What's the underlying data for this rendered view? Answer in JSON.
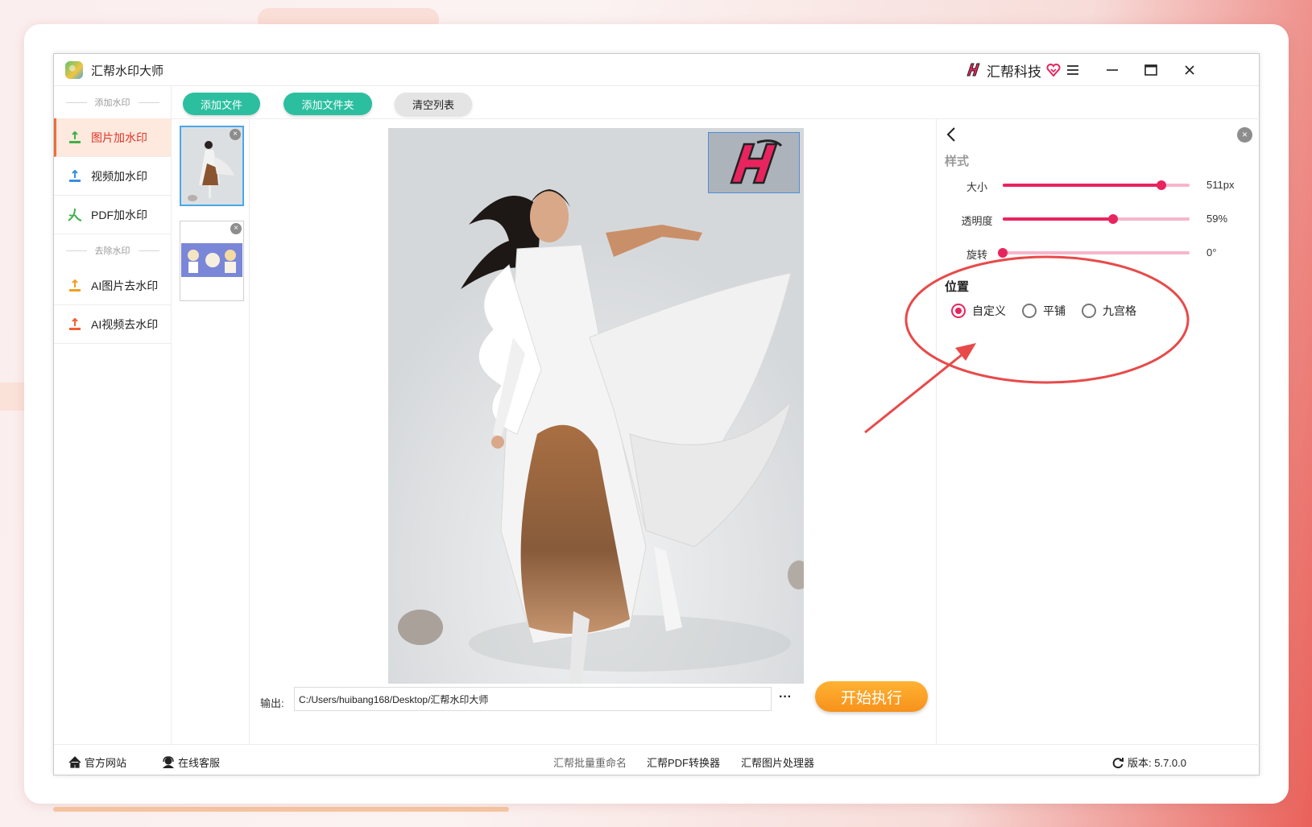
{
  "window": {
    "title": "汇帮水印大师",
    "brand": "汇帮科技"
  },
  "sidebar": {
    "section_add": "添加水印",
    "section_remove": "去除水印",
    "items_add": [
      {
        "label": "图片加水印",
        "icon": "image-upload-icon",
        "color": "#3fb04b"
      },
      {
        "label": "视频加水印",
        "icon": "video-upload-icon",
        "color": "#3a8fe0"
      },
      {
        "label": "PDF加水印",
        "icon": "pdf-icon",
        "color": "#3fb04b"
      }
    ],
    "items_remove": [
      {
        "label": "AI图片去水印",
        "icon": "image-remove-icon",
        "color": "#f0a020"
      },
      {
        "label": "AI视频去水印",
        "icon": "video-remove-icon",
        "color": "#f06030"
      }
    ]
  },
  "toolbar": {
    "add_file": "添加文件",
    "add_folder": "添加文件夹",
    "clear_list": "清空列表"
  },
  "output": {
    "label": "输出:",
    "path": "C:/Users/huibang168/Desktop/汇帮水印大师",
    "more": "···",
    "start": "开始执行"
  },
  "panel": {
    "style_title": "样式",
    "sliders": [
      {
        "label": "大小",
        "value": "511px",
        "fraction": 0.85
      },
      {
        "label": "透明度",
        "value": "59%",
        "fraction": 0.59
      },
      {
        "label": "旋转",
        "value": "0°",
        "fraction": 0.0
      }
    ],
    "position_title": "位置",
    "position_options": [
      "自定义",
      "平铺",
      "九宫格"
    ],
    "position_selected": 0
  },
  "footer": {
    "website": "官方网站",
    "support": "在线客服",
    "rename": "汇帮批量重命名",
    "pdf_converter": "汇帮PDF转换器",
    "image_processor": "汇帮图片处理器",
    "version": "版本: 5.7.0.0"
  },
  "colors": {
    "accent": "#e8245f",
    "teal": "#2bbfa0",
    "orange": "#f7921c",
    "active_nav": "#e5332a",
    "annotation": "#e84a4a"
  }
}
